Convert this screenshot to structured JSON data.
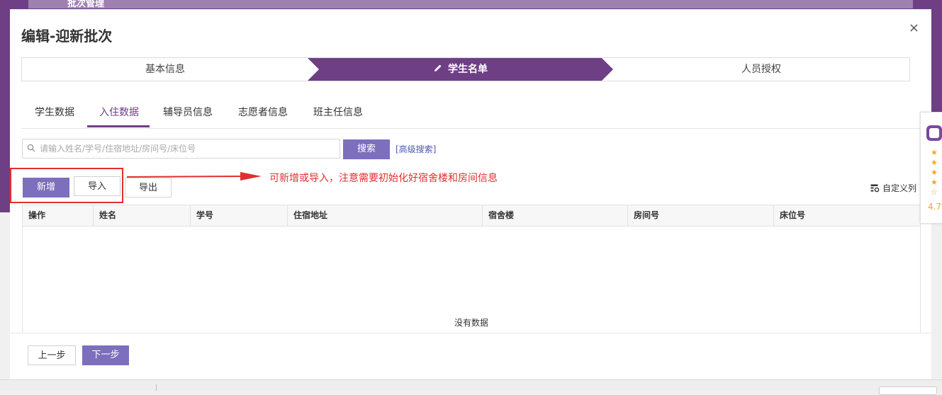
{
  "background": {
    "title": "批次管理"
  },
  "modal": {
    "title": "编辑-迎新批次",
    "close_symbol": "×"
  },
  "steps": [
    {
      "label": "基本信息",
      "active": false
    },
    {
      "label": "学生名单",
      "active": true,
      "icon": "pencil-icon"
    },
    {
      "label": "人员授权",
      "active": false
    }
  ],
  "tabs": [
    {
      "label": "学生数据",
      "active": false
    },
    {
      "label": "入住数据",
      "active": true
    },
    {
      "label": "辅导员信息",
      "active": false
    },
    {
      "label": "志愿者信息",
      "active": false
    },
    {
      "label": "班主任信息",
      "active": false
    }
  ],
  "search": {
    "placeholder": "请输入姓名/学号/住宿地址/房间号/床位号",
    "value": "",
    "button_label": "搜索",
    "advanced_label": "[高级搜索]"
  },
  "toolbar": {
    "new_label": "新增",
    "import_label": "导入",
    "export_label": "导出",
    "custom_columns_label": "自定义列"
  },
  "annotation": "可新增或导入，注意需要初始化好宿舍楼和房间信息",
  "table": {
    "columns": [
      "操作",
      "姓名",
      "学号",
      "住宿地址",
      "宿舍楼",
      "房间号",
      "床位号"
    ],
    "rows": [],
    "empty_text": "没有数据"
  },
  "footer": {
    "prev_label": "上一步",
    "next_label": "下一步"
  },
  "side_widget": {
    "stars": [
      "★",
      "★",
      "★",
      "★",
      "☆"
    ],
    "rating": "4.7"
  },
  "colors": {
    "brand_purple": "#6e3f85",
    "button_blue": "#7d6fbd",
    "annotation_red": "#e03030"
  }
}
